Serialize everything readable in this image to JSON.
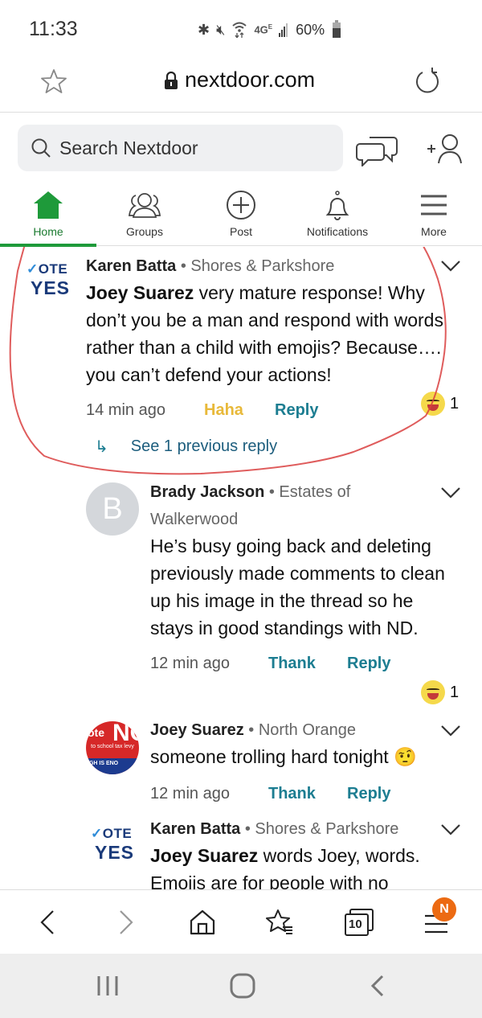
{
  "status_bar": {
    "time": "11:33",
    "icons": [
      "bluetooth-icon",
      "mute-icon",
      "wifi-icon",
      "4g-icon",
      "signal-icon"
    ],
    "battery_percent": "60%"
  },
  "browser": {
    "url": "nextdoor.com",
    "open_tabs_count": "10",
    "menu_badge": "N"
  },
  "header": {
    "search_placeholder": "Search Nextdoor"
  },
  "tabs": [
    {
      "label": "Home",
      "active": true
    },
    {
      "label": "Groups",
      "active": false
    },
    {
      "label": "Post",
      "active": false
    },
    {
      "label": "Notifications",
      "active": false
    },
    {
      "label": "More",
      "active": false
    }
  ],
  "comments": [
    {
      "author": "Karen Batta",
      "neighborhood": "Shores & Parkshore",
      "mention": "Joey Suarez",
      "text_lines": [
        " very mature response! Why",
        "don’t you be a man and respond with words",
        "rather than a child with emojis? Because….",
        "you can’t defend your actions!"
      ],
      "time": "14 min ago",
      "reaction_label": "Haha",
      "reply_label": "Reply",
      "reaction_count": "1",
      "see_previous": "See 1 previous reply"
    },
    {
      "author": "Brady Jackson",
      "neighborhood_line1": "Estates of",
      "neighborhood_line2": "Walkerwood",
      "avatar_initial": "B",
      "text_lines": [
        "He’s busy going back and deleting",
        "previously made comments to clean",
        "up his image in the thread so he",
        "stays in good standings with ND."
      ],
      "time": "12 min ago",
      "reaction_label": "Thank",
      "reply_label": "Reply",
      "reaction_count": "1"
    },
    {
      "author": "Joey Suarez",
      "neighborhood": "North Orange",
      "text": "someone trolling hard tonight",
      "emoji": "🤨",
      "avatar": {
        "ote": "ote",
        "no": "NO",
        "levy": "to school tax levy",
        "band": "IGH IS ENO"
      },
      "time": "12 min ago",
      "reaction_label": "Thank",
      "reply_label": "Reply"
    },
    {
      "author": "Karen Batta",
      "neighborhood": "Shores & Parkshore",
      "mention": "Joey Suarez",
      "text_lines": [
        " words Joey, words.",
        "Emojis are for people with no"
      ]
    }
  ],
  "vote_yes_avatar": {
    "vote": "OTE",
    "check": "✓",
    "yes": "YES"
  },
  "colors": {
    "brand_green": "#1e9a3a",
    "link_teal": "#1c7d91",
    "haha_yellow": "#e8b93a",
    "badge_orange": "#ec6a12",
    "annotation_red": "#d9403f"
  }
}
